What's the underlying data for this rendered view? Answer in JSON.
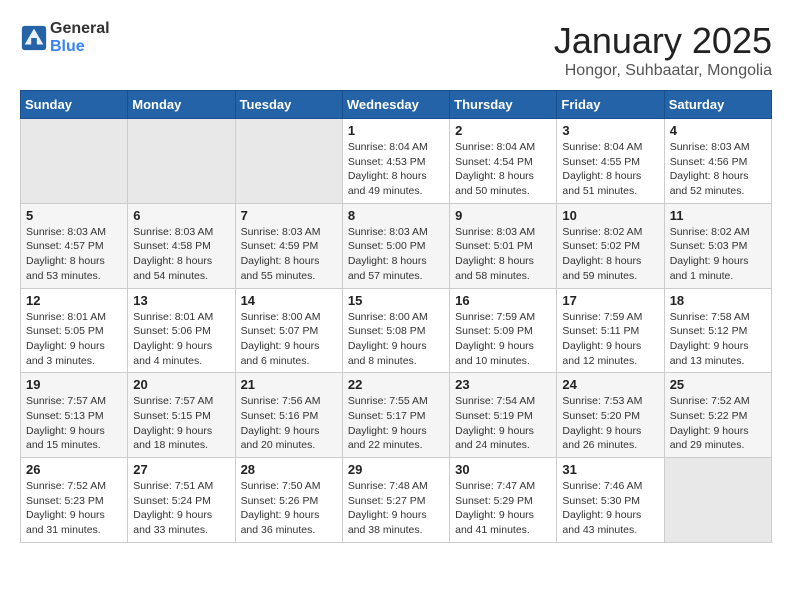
{
  "logo": {
    "general": "General",
    "blue": "Blue"
  },
  "header": {
    "title": "January 2025",
    "subtitle": "Hongor, Suhbaatar, Mongolia"
  },
  "days_of_week": [
    "Sunday",
    "Monday",
    "Tuesday",
    "Wednesday",
    "Thursday",
    "Friday",
    "Saturday"
  ],
  "weeks": [
    [
      {
        "day": "",
        "info": ""
      },
      {
        "day": "",
        "info": ""
      },
      {
        "day": "",
        "info": ""
      },
      {
        "day": "1",
        "info": "Sunrise: 8:04 AM\nSunset: 4:53 PM\nDaylight: 8 hours\nand 49 minutes."
      },
      {
        "day": "2",
        "info": "Sunrise: 8:04 AM\nSunset: 4:54 PM\nDaylight: 8 hours\nand 50 minutes."
      },
      {
        "day": "3",
        "info": "Sunrise: 8:04 AM\nSunset: 4:55 PM\nDaylight: 8 hours\nand 51 minutes."
      },
      {
        "day": "4",
        "info": "Sunrise: 8:03 AM\nSunset: 4:56 PM\nDaylight: 8 hours\nand 52 minutes."
      }
    ],
    [
      {
        "day": "5",
        "info": "Sunrise: 8:03 AM\nSunset: 4:57 PM\nDaylight: 8 hours\nand 53 minutes."
      },
      {
        "day": "6",
        "info": "Sunrise: 8:03 AM\nSunset: 4:58 PM\nDaylight: 8 hours\nand 54 minutes."
      },
      {
        "day": "7",
        "info": "Sunrise: 8:03 AM\nSunset: 4:59 PM\nDaylight: 8 hours\nand 55 minutes."
      },
      {
        "day": "8",
        "info": "Sunrise: 8:03 AM\nSunset: 5:00 PM\nDaylight: 8 hours\nand 57 minutes."
      },
      {
        "day": "9",
        "info": "Sunrise: 8:03 AM\nSunset: 5:01 PM\nDaylight: 8 hours\nand 58 minutes."
      },
      {
        "day": "10",
        "info": "Sunrise: 8:02 AM\nSunset: 5:02 PM\nDaylight: 8 hours\nand 59 minutes."
      },
      {
        "day": "11",
        "info": "Sunrise: 8:02 AM\nSunset: 5:03 PM\nDaylight: 9 hours\nand 1 minute."
      }
    ],
    [
      {
        "day": "12",
        "info": "Sunrise: 8:01 AM\nSunset: 5:05 PM\nDaylight: 9 hours\nand 3 minutes."
      },
      {
        "day": "13",
        "info": "Sunrise: 8:01 AM\nSunset: 5:06 PM\nDaylight: 9 hours\nand 4 minutes."
      },
      {
        "day": "14",
        "info": "Sunrise: 8:00 AM\nSunset: 5:07 PM\nDaylight: 9 hours\nand 6 minutes."
      },
      {
        "day": "15",
        "info": "Sunrise: 8:00 AM\nSunset: 5:08 PM\nDaylight: 9 hours\nand 8 minutes."
      },
      {
        "day": "16",
        "info": "Sunrise: 7:59 AM\nSunset: 5:09 PM\nDaylight: 9 hours\nand 10 minutes."
      },
      {
        "day": "17",
        "info": "Sunrise: 7:59 AM\nSunset: 5:11 PM\nDaylight: 9 hours\nand 12 minutes."
      },
      {
        "day": "18",
        "info": "Sunrise: 7:58 AM\nSunset: 5:12 PM\nDaylight: 9 hours\nand 13 minutes."
      }
    ],
    [
      {
        "day": "19",
        "info": "Sunrise: 7:57 AM\nSunset: 5:13 PM\nDaylight: 9 hours\nand 15 minutes."
      },
      {
        "day": "20",
        "info": "Sunrise: 7:57 AM\nSunset: 5:15 PM\nDaylight: 9 hours\nand 18 minutes."
      },
      {
        "day": "21",
        "info": "Sunrise: 7:56 AM\nSunset: 5:16 PM\nDaylight: 9 hours\nand 20 minutes."
      },
      {
        "day": "22",
        "info": "Sunrise: 7:55 AM\nSunset: 5:17 PM\nDaylight: 9 hours\nand 22 minutes."
      },
      {
        "day": "23",
        "info": "Sunrise: 7:54 AM\nSunset: 5:19 PM\nDaylight: 9 hours\nand 24 minutes."
      },
      {
        "day": "24",
        "info": "Sunrise: 7:53 AM\nSunset: 5:20 PM\nDaylight: 9 hours\nand 26 minutes."
      },
      {
        "day": "25",
        "info": "Sunrise: 7:52 AM\nSunset: 5:22 PM\nDaylight: 9 hours\nand 29 minutes."
      }
    ],
    [
      {
        "day": "26",
        "info": "Sunrise: 7:52 AM\nSunset: 5:23 PM\nDaylight: 9 hours\nand 31 minutes."
      },
      {
        "day": "27",
        "info": "Sunrise: 7:51 AM\nSunset: 5:24 PM\nDaylight: 9 hours\nand 33 minutes."
      },
      {
        "day": "28",
        "info": "Sunrise: 7:50 AM\nSunset: 5:26 PM\nDaylight: 9 hours\nand 36 minutes."
      },
      {
        "day": "29",
        "info": "Sunrise: 7:48 AM\nSunset: 5:27 PM\nDaylight: 9 hours\nand 38 minutes."
      },
      {
        "day": "30",
        "info": "Sunrise: 7:47 AM\nSunset: 5:29 PM\nDaylight: 9 hours\nand 41 minutes."
      },
      {
        "day": "31",
        "info": "Sunrise: 7:46 AM\nSunset: 5:30 PM\nDaylight: 9 hours\nand 43 minutes."
      },
      {
        "day": "",
        "info": ""
      }
    ]
  ]
}
